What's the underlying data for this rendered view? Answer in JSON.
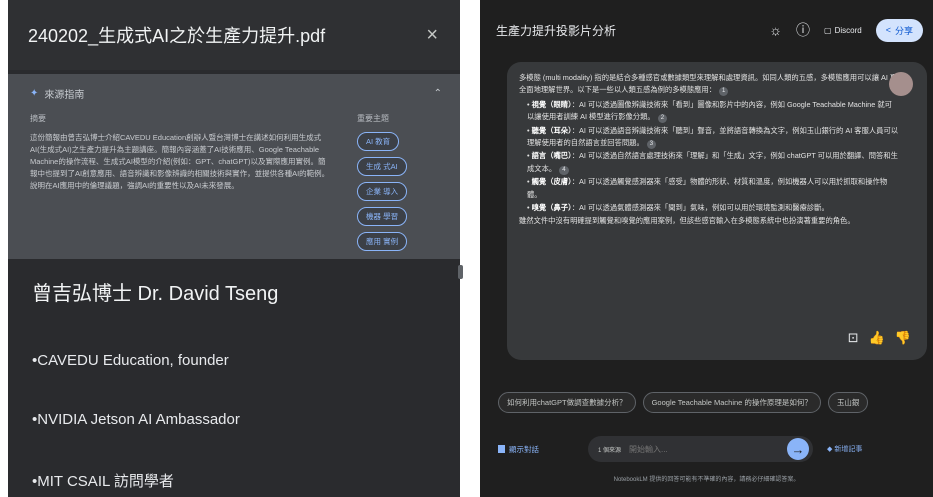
{
  "source": {
    "title": "240202_生成式AI之於生產力提升.pdf",
    "close_icon": "×",
    "guide": {
      "label": "來源指南",
      "summary_label": "摘要",
      "topics_label": "重要主題",
      "summary_text": "這份簡報由曾吉弘博士介紹CAVEDU Education創辦人暨台灣博士在講述如何利用生成式AI(生成式AI)之生產力提升為主題講座。簡報內容涵蓋了AI技術應用、Google Teachable Machine的操作流程、生成式AI模型的介紹(例如：GPT、chatGPT)以及實際應用實例。簡報中也提到了AI創意應用、語音辨識和影像辨識的相關技術與實作，並提供各種AI的範例。說明在AI應用中的倫理議題，強調AI的重要性以及AI未來發展。",
      "topics": [
        "AI 教育",
        "生成 式AI",
        "企業 導入",
        "機器 學習",
        "應用 實例"
      ]
    },
    "author": "曾吉弘博士 Dr. David Tseng",
    "bullets": [
      "•CAVEDU Education, founder",
      "•NVIDIA Jetson AI Ambassador",
      "•MIT CSAIL 訪問學者"
    ]
  },
  "notebook": {
    "title": "生產力提升投影片分析",
    "discord_label": "Discord",
    "share_label": "分享",
    "icons": {
      "theme": "sun-icon",
      "help": "help-icon",
      "share": "share-icon"
    }
  },
  "answer": {
    "intro": "多模態 (multi modality) 指的是結合多種感官或數據類型來理解和處理資訊。如同人類的五感，多模態應用可以讓 AI 更全面地理解世界。以下是一些以人類五感為例的多模態應用：",
    "items": [
      {
        "head": "視覺（眼睛）",
        "text": "：AI 可以透過圖像辨識技術來「看到」圖像和影片中的內容，例如 Google Teachable Machine 就可以讓使用者訓練 AI 模型進行影像分類。"
      },
      {
        "head": "聽覺（耳朵）",
        "text": "：AI 可以透過語音辨識技術來「聽到」聲音，並將語音轉換為文字，例如玉山銀行的 AI 客服人員可以理解使用者的自然語言並回答問題。"
      },
      {
        "head": "語言（嘴巴）",
        "text": "：AI 可以透過自然語言處理技術來「理解」和「生成」文字，例如 chatGPT 可以用於翻譯、問答和生成文本。"
      },
      {
        "head": "觸覺（皮膚）",
        "text": "：AI 可以透過觸覺感測器來「感受」物體的形狀、材質和溫度，例如機器人可以用於抓取和操作物體。"
      },
      {
        "head": "嗅覺（鼻子）",
        "text": "：AI 可以透過氣體感測器來「聞到」氣味，例如可以用於環境監測和醫療診斷。"
      }
    ],
    "outro": "雖然文件中沒有明確提到觸覺和嗅覺的應用案例，但該些感官輸入在多模態系統中也扮演著重要的角色。",
    "cite_numbers": [
      "1",
      "2",
      "3",
      "4"
    ]
  },
  "suggestions": [
    "如何利用chatGPT做調查數據分析？",
    "Google Teachable Machine 的操作原理是如何？",
    "玉山銀"
  ],
  "composer": {
    "notes_label": "顯示對話",
    "source_count": "1 個來源",
    "placeholder": "開始輸入...",
    "send_icon": "arrow-right-icon",
    "save_note_label": "新增記事",
    "disclaimer": "NotebookLM 提供的回答可能有不準確的內容，請務必仔細確認答案。"
  }
}
